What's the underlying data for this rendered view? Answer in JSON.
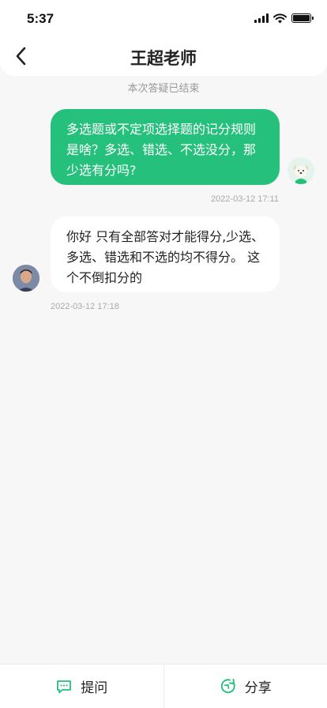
{
  "status_bar": {
    "time": "5:37"
  },
  "header": {
    "title": "王超老师",
    "back_icon": "chevron-left-icon"
  },
  "session_status": "本次答疑已结束",
  "messages": [
    {
      "direction": "outgoing",
      "text": "多选题或不定项选择题的记分规则是啥？多选、错选、不选没分，那少选有分吗?",
      "timestamp": "2022-03-12 17:11",
      "bubble_color": "#25c07c"
    },
    {
      "direction": "incoming",
      "text": "你好 只有全部答对才能得分,少选、多选、错选和不选的均不得分。 这个不倒扣分的",
      "timestamp": "2022-03-12 17:18",
      "bubble_color": "#ffffff"
    }
  ],
  "bottom_bar": {
    "ask_label": "提问",
    "ask_icon": "chat-icon",
    "share_label": "分享",
    "share_icon": "share-icon",
    "accent_color": "#25c07c"
  }
}
